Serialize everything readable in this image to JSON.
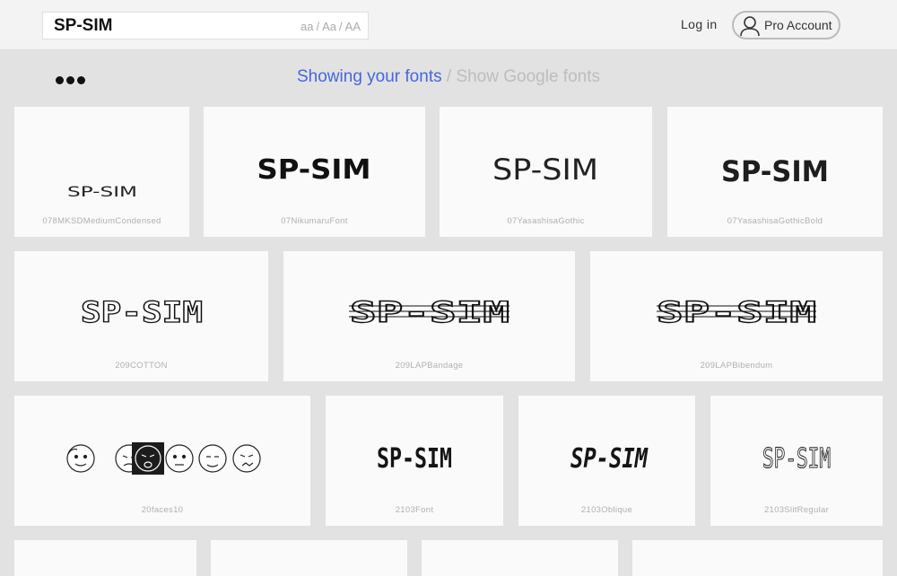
{
  "search": {
    "value": "SP-SIM",
    "case_lower": "aa",
    "case_title": "Aa",
    "case_upper": "AA",
    "case_sep": "/"
  },
  "header": {
    "login_label": "Log in",
    "pro_label": "Pro Account"
  },
  "source_toggle": {
    "active_label": "Showing your fonts",
    "separator": "/",
    "inactive_label": "Show Google fonts"
  },
  "sample_text": "SP-SIM",
  "rows": [
    [
      {
        "font": "078MKSDMediumCondensed"
      },
      {
        "font": "07NikumaruFont"
      },
      {
        "font": "07YasashisaGothic"
      },
      {
        "font": "07YasashisaGothicBold"
      }
    ],
    [
      {
        "font": "209COTTON"
      },
      {
        "font": "209LAPBandage"
      },
      {
        "font": "209LAPBibendum"
      }
    ],
    [
      {
        "font": "20faces10"
      },
      {
        "font": "2103Font"
      },
      {
        "font": "2103Oblique"
      },
      {
        "font": "2103SlitRegular"
      }
    ]
  ]
}
